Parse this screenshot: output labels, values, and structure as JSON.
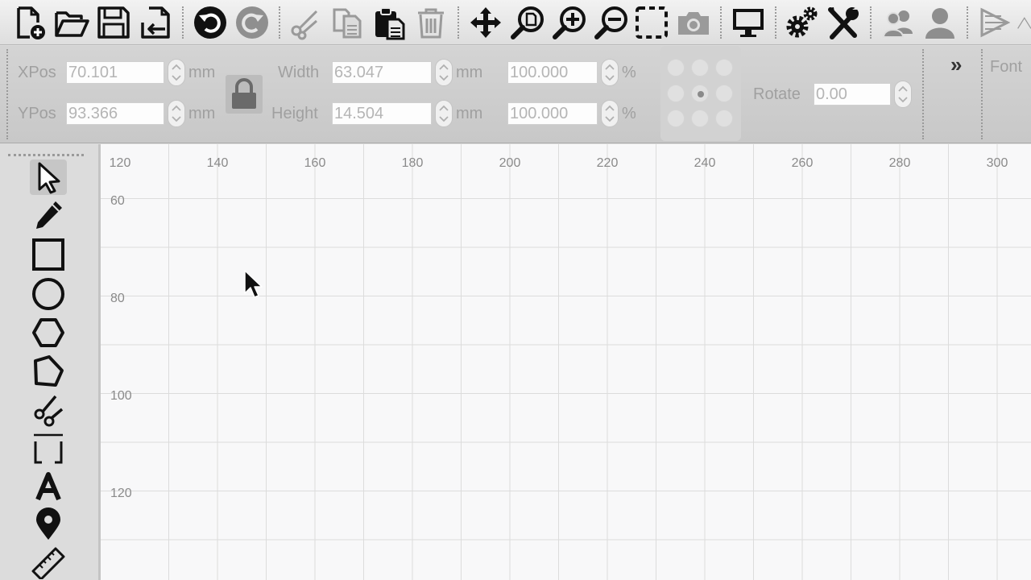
{
  "toolbar": {
    "buttons": [
      {
        "name": "new-file",
        "icon": "file-plus-icon"
      },
      {
        "name": "open-file",
        "icon": "folder-open-icon"
      },
      {
        "name": "save-file",
        "icon": "floppy-disk-icon"
      },
      {
        "name": "import-file",
        "icon": "file-import-icon"
      },
      {
        "name": "undo",
        "icon": "undo-icon"
      },
      {
        "name": "redo",
        "icon": "redo-icon"
      },
      {
        "name": "cut",
        "icon": "scissors-icon"
      },
      {
        "name": "copy",
        "icon": "copy-icon"
      },
      {
        "name": "paste",
        "icon": "clipboard-icon"
      },
      {
        "name": "delete",
        "icon": "trash-icon"
      },
      {
        "name": "pan",
        "icon": "move-arrows-icon"
      },
      {
        "name": "zoom-page",
        "icon": "zoom-page-icon"
      },
      {
        "name": "zoom-in",
        "icon": "zoom-in-icon"
      },
      {
        "name": "zoom-out",
        "icon": "zoom-out-icon"
      },
      {
        "name": "select-frame",
        "icon": "dashed-frame-icon"
      },
      {
        "name": "camera",
        "icon": "camera-icon"
      },
      {
        "name": "devices",
        "icon": "monitor-icon"
      },
      {
        "name": "settings",
        "icon": "gears-icon"
      },
      {
        "name": "tools",
        "icon": "wrench-screwdriver-icon"
      },
      {
        "name": "users",
        "icon": "users-icon"
      },
      {
        "name": "user",
        "icon": "user-icon"
      },
      {
        "name": "mirror",
        "icon": "mirror-icon"
      }
    ]
  },
  "properties": {
    "xpos": {
      "label": "XPos",
      "value": "70.101",
      "unit": "mm"
    },
    "ypos": {
      "label": "YPos",
      "value": "93.366",
      "unit": "mm"
    },
    "width": {
      "label": "Width",
      "value": "63.047",
      "unit": "mm",
      "percent": "100.000",
      "percent_unit": "%"
    },
    "height": {
      "label": "Height",
      "value": "14.504",
      "unit": "mm",
      "percent": "100.000",
      "percent_unit": "%"
    },
    "rotate": {
      "label": "Rotate",
      "value": "0.00"
    },
    "lock_icon": "padlock-icon",
    "overflow_label": "»",
    "font_label": "Font"
  },
  "tools": [
    {
      "name": "select",
      "icon": "pointer-arrow-icon",
      "active": true
    },
    {
      "name": "pencil",
      "icon": "pencil-icon"
    },
    {
      "name": "rectangle",
      "icon": "rectangle-icon"
    },
    {
      "name": "ellipse",
      "icon": "circle-icon"
    },
    {
      "name": "polygon",
      "icon": "hexagon-icon"
    },
    {
      "name": "polyline",
      "icon": "pentagon-icon"
    },
    {
      "name": "cut-shape",
      "icon": "scissors-icon"
    },
    {
      "name": "frame",
      "icon": "frame-corners-icon"
    },
    {
      "name": "text",
      "icon": "text-a-icon"
    },
    {
      "name": "position",
      "icon": "map-pin-icon"
    },
    {
      "name": "measure",
      "icon": "ruler-icon"
    }
  ],
  "ruler": {
    "x_labels": [
      "120",
      "140",
      "160",
      "180",
      "200",
      "220",
      "240",
      "260",
      "280",
      "300"
    ],
    "y_labels": [
      "60",
      "80",
      "100",
      "120"
    ]
  },
  "colors": {
    "icon": "#111111",
    "icon_disabled": "#9a9a9a",
    "grid": "#dcdcdc",
    "canvas": "#f8f8f9"
  }
}
